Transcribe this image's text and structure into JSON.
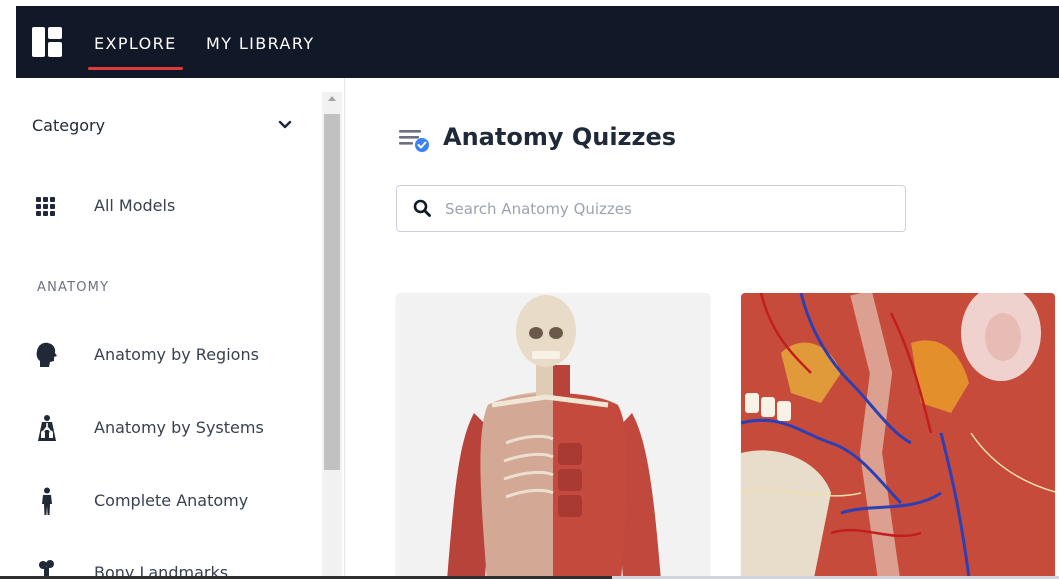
{
  "nav": {
    "tabs": [
      {
        "label": "EXPLORE",
        "active": true
      },
      {
        "label": "MY LIBRARY",
        "active": false
      }
    ]
  },
  "sidebar": {
    "category_label": "Category",
    "all_models": "All Models",
    "section_heading": "ANATOMY",
    "items": [
      {
        "label": "Anatomy by Regions",
        "icon": "head-silhouette-icon"
      },
      {
        "label": "Anatomy by Systems",
        "icon": "lungs-torso-icon"
      },
      {
        "label": "Complete Anatomy",
        "icon": "human-figure-icon"
      },
      {
        "label": "Bony Landmarks",
        "icon": "bone-icon"
      }
    ]
  },
  "main": {
    "title": "Anatomy Quizzes",
    "search_placeholder": "Search Anatomy Quizzes"
  },
  "colors": {
    "topbar": "#111827",
    "accent_underline": "#e03a3a",
    "title_icon_badge": "#3b82f6"
  }
}
